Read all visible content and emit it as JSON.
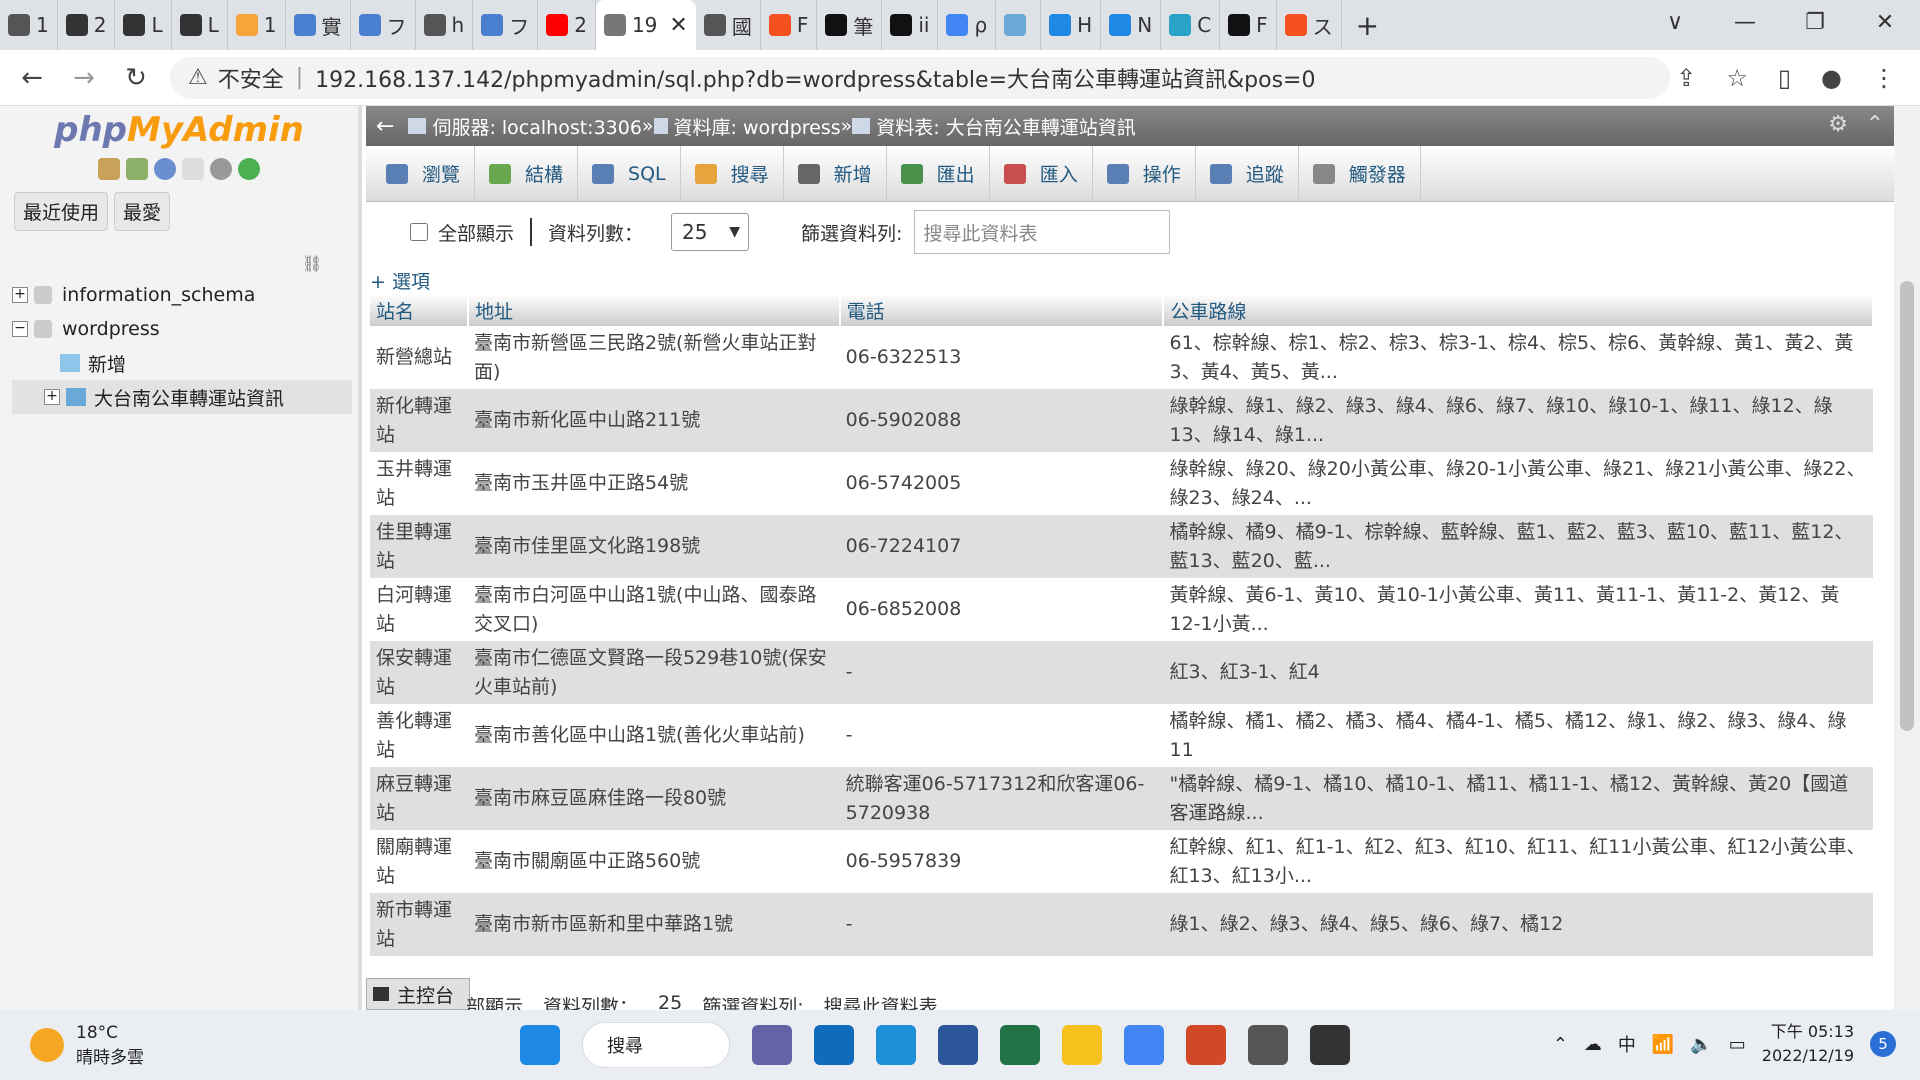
{
  "browser": {
    "tabs": [
      {
        "label": "1",
        "color": "#555"
      },
      {
        "label": "2",
        "color": "#333"
      },
      {
        "label": "L",
        "color": "#333"
      },
      {
        "label": "L",
        "color": "#333"
      },
      {
        "label": "1",
        "color": "#f6a53a"
      },
      {
        "label": "實",
        "color": "#4a7fcf"
      },
      {
        "label": "フ",
        "color": "#4a7fcf"
      },
      {
        "label": "h",
        "color": "#555"
      },
      {
        "label": "フ",
        "color": "#4a7fcf"
      },
      {
        "label": "2",
        "color": "#ff0000"
      },
      {
        "label": "19",
        "color": "#777",
        "active": true
      },
      {
        "label": "國",
        "color": "#555"
      },
      {
        "label": "F",
        "color": "#f4511e"
      },
      {
        "label": "筆",
        "color": "#111"
      },
      {
        "label": "ii",
        "color": "#111"
      },
      {
        "label": "ρ",
        "color": "#4285f4"
      },
      {
        "label": "",
        "color": "#6aa8d8"
      },
      {
        "label": "H",
        "color": "#1e88e5"
      },
      {
        "label": "N",
        "color": "#1e88e5"
      },
      {
        "label": "C",
        "color": "#29a3c7"
      },
      {
        "label": "F",
        "color": "#111"
      },
      {
        "label": "ス",
        "color": "#f4511e"
      }
    ],
    "close_tab": "✕",
    "new_tab": "+",
    "window_controls": [
      "∨",
      "—",
      "❐",
      "✕"
    ],
    "nav": {
      "back": "←",
      "forward": "→",
      "reload": "↻"
    },
    "address": {
      "insecure_label": "不安全",
      "url": "192.168.137.142/phpmyadmin/sql.php?db=wordpress&table=大台南公車轉運站資訊&pos=0"
    }
  },
  "sidebar": {
    "logo_php": "php",
    "logo_myadmin": "MyAdmin",
    "recent_btn": "最近使用",
    "fav_btn": "最愛",
    "tree": {
      "db1": "information_schema",
      "db2": "wordpress",
      "new": "新增",
      "table": "大台南公車轉運站資訊"
    }
  },
  "breadcrumb": {
    "server": "伺服器: localhost:3306",
    "sep1": " » ",
    "database": "資料庫: wordpress",
    "sep2": " » ",
    "table": "資料表: 大台南公車轉運站資訊"
  },
  "menu": [
    {
      "label": "瀏覽",
      "color": "#5a7fb5"
    },
    {
      "label": "結構",
      "color": "#6aa84f"
    },
    {
      "label": "SQL",
      "color": "#5a7fb5"
    },
    {
      "label": "搜尋",
      "color": "#e7a33e"
    },
    {
      "label": "新增",
      "color": "#666"
    },
    {
      "label": "匯出",
      "color": "#4a8f4a"
    },
    {
      "label": "匯入",
      "color": "#c94f4f"
    },
    {
      "label": "操作",
      "color": "#5a7fb5"
    },
    {
      "label": "追蹤",
      "color": "#5a7fb5"
    },
    {
      "label": "觸發器",
      "color": "#888"
    }
  ],
  "controls": {
    "show_all": "全部顯示",
    "rows_label": "資料列數：",
    "rows_value": "25",
    "filter_label": "篩選資料列:",
    "filter_placeholder": "搜尋此資料表"
  },
  "options_link": "+ 選項",
  "table": {
    "headers": [
      "站名",
      "地址",
      "電話",
      "公車路線"
    ],
    "rows": [
      [
        "新營總站",
        "臺南市新營區三民路2號(新營火車站正對面)",
        "06-6322513",
        "61、棕幹線、棕1、棕2、棕3、棕3-1、棕4、棕5、棕6、黃幹線、黃1、黃2、黃3、黃4、黃5、黃..."
      ],
      [
        "新化轉運站",
        "臺南市新化區中山路211號",
        "06-5902088",
        "綠幹線、綠1、綠2、綠3、綠4、綠6、綠7、綠10、綠10-1、綠11、綠12、綠13、綠14、綠1..."
      ],
      [
        "玉井轉運站",
        "臺南市玉井區中正路54號",
        "06-5742005",
        "綠幹線、綠20、綠20小黃公車、綠20-1小黃公車、綠21、綠21小黃公車、綠22、綠23、綠24、..."
      ],
      [
        "佳里轉運站",
        "臺南市佳里區文化路198號",
        "06-7224107",
        "橘幹線、橘9、橘9-1、棕幹線、藍幹線、藍1、藍2、藍3、藍10、藍11、藍12、藍13、藍20、藍..."
      ],
      [
        "白河轉運站",
        "臺南市白河區中山路1號(中山路、國泰路交叉口)",
        "06-6852008",
        "黃幹線、黃6-1、黃10、黃10-1小黃公車、黃11、黃11-1、黃11-2、黃12、黃12-1小黃..."
      ],
      [
        "保安轉運站",
        "臺南市仁德區文賢路一段529巷10號(保安火車站前)",
        "-",
        "紅3、紅3-1、紅4"
      ],
      [
        "善化轉運站",
        "臺南市善化區中山路1號(善化火車站前)",
        "-",
        "橘幹線、橘1、橘2、橘3、橘4、橘4-1、橘5、橘12、綠1、綠2、綠3、綠4、綠11"
      ],
      [
        "麻豆轉運站",
        "臺南市麻豆區麻佳路一段80號",
        "統聯客運06-5717312和欣客運06-5720938",
        "\"橘幹線、橘9-1、橘10、橘10-1、橘11、橘11-1、橘12、黃幹線、黃20【國道客運路線..."
      ],
      [
        "關廟轉運站",
        "臺南市關廟區中正路560號",
        "06-5957839",
        "紅幹線、紅1、紅1-1、紅2、紅3、紅10、紅11、紅11小黃公車、紅12小黃公車、紅13、紅13小..."
      ],
      [
        "新市轉運站",
        "臺南市新市區新和里中華路1號",
        "-",
        "綠1、綠2、綠3、綠4、綠5、綠6、綠7、橘12"
      ]
    ]
  },
  "console": "主控台",
  "ghost_controls": {
    "a": "部顯示",
    "b": "資料列數：",
    "c": "25",
    "d": "篩選資料列:",
    "e": "搜尋此資料表"
  },
  "taskbar": {
    "temp": "18°C",
    "weather": "晴時多雲",
    "search": "搜尋",
    "ime": "中",
    "time": "下午 05:13",
    "date": "2022/12/19",
    "notifications": "5",
    "apps": [
      "#1e88e5",
      "#111",
      "#6264a7",
      "#0f6cbd",
      "#1d8fd9",
      "#2b579a",
      "#217346",
      "#f7c11d",
      "#4285f4",
      "#d24726",
      "#555",
      "#333"
    ]
  }
}
